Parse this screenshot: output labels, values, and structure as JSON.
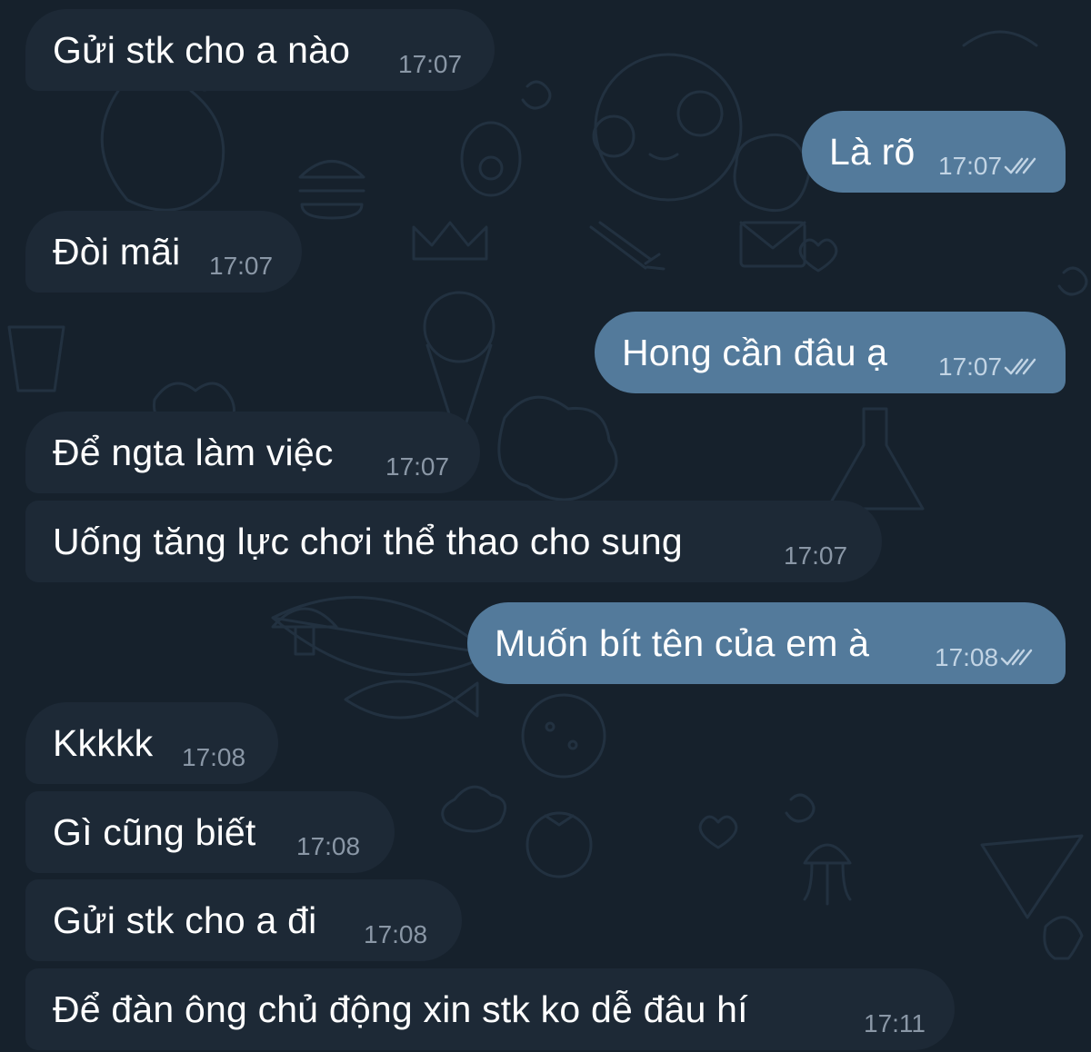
{
  "colors": {
    "background": "#16212c",
    "incoming_bubble": "#1d2936",
    "outgoing_bubble": "#537a9b",
    "incoming_time": "#8a97a6",
    "outgoing_time": "#c2d4e4"
  },
  "messages": [
    {
      "direction": "incoming",
      "text": "Gửi stk cho a nào",
      "time": "17:07"
    },
    {
      "direction": "outgoing",
      "text": "Là rõ",
      "time": "17:07",
      "status_icon": "double-check-icon"
    },
    {
      "direction": "incoming",
      "text": "Đòi mãi",
      "time": "17:07"
    },
    {
      "direction": "outgoing",
      "text": "Hong cần đâu ạ",
      "time": "17:07",
      "status_icon": "double-check-icon"
    },
    {
      "direction": "incoming",
      "text": "Để ngta làm việc",
      "time": "17:07"
    },
    {
      "direction": "incoming",
      "text": "Uống tăng lực chơi thể thao cho sung",
      "time": "17:07"
    },
    {
      "direction": "outgoing",
      "text": "Muốn bít tên của em à",
      "time": "17:08",
      "status_icon": "double-check-icon"
    },
    {
      "direction": "incoming",
      "text": "Kkkkk",
      "time": "17:08"
    },
    {
      "direction": "incoming",
      "text": "Gì cũng biết",
      "time": "17:08"
    },
    {
      "direction": "incoming",
      "text": "Gửi stk cho a đi",
      "time": "17:08"
    },
    {
      "direction": "incoming",
      "text": "Để đàn ông chủ động xin stk ko dễ đâu hí",
      "time": "17:11"
    }
  ]
}
